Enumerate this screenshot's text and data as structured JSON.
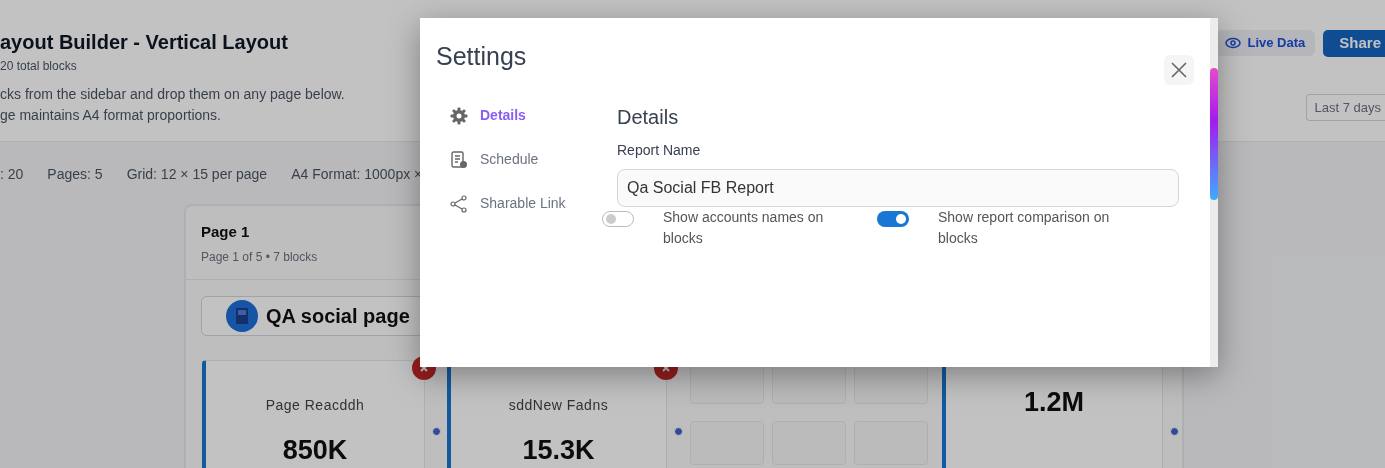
{
  "app_header": {
    "title": "ayout Builder - Vertical Layout",
    "subtitle": "20 total blocks",
    "description": [
      "cks from the sidebar and drop them on any page below.",
      "ge maintains A4 format proportions."
    ],
    "live_data_button": "Live Data",
    "share_button": "Share",
    "date_range": "Last 7 days"
  },
  "stats": [
    ": 20",
    "Pages: 5",
    "Grid: 12 × 15 per page",
    "A4 Format: 1000px ×"
  ],
  "page": {
    "title": "Page 1",
    "subtitle": "Page 1 of 5 • 7 blocks",
    "header_block": "QA social page",
    "blocks": [
      {
        "kind": "metric",
        "label": "Page Reacddh",
        "value": "850K"
      },
      {
        "kind": "metric",
        "label": "sddNew Fadns",
        "value": "15.3K"
      },
      {
        "kind": "empty"
      },
      {
        "kind": "metric",
        "value": "1.2M"
      }
    ]
  },
  "modal": {
    "title": "Settings",
    "nav": [
      {
        "kind": "gear",
        "label": "Details",
        "selected": true
      },
      {
        "kind": "schedule",
        "label": "Schedule",
        "selected": false
      },
      {
        "kind": "share",
        "label": "Sharable Link",
        "selected": false
      }
    ],
    "section_title": "Details",
    "field": {
      "label": "Report Name",
      "value": "Qa Social FB Report"
    },
    "toggles": [
      {
        "label": "Show accounts names on blocks",
        "on": false
      },
      {
        "label": "Show report comparison on blocks",
        "on": true
      }
    ]
  }
}
